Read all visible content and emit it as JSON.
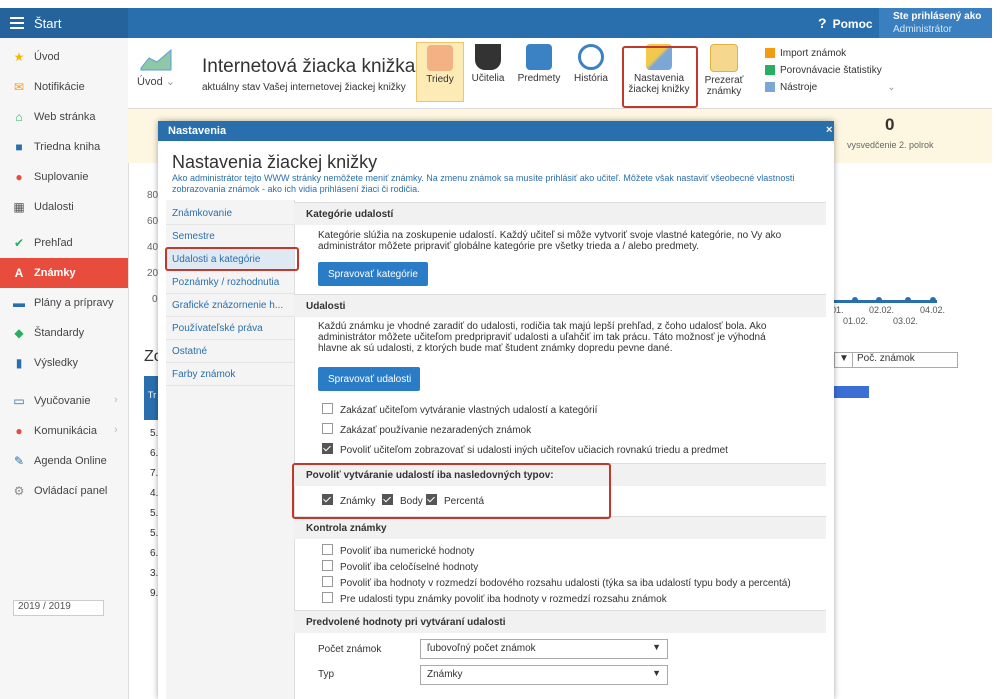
{
  "topbar": {
    "app_label": "Štart",
    "help": "Pomoc",
    "user_line1": "Ste prihlásený ako",
    "user_line2": "Administrátor"
  },
  "sidebar": {
    "items": [
      {
        "label": "Úvod",
        "icon": "star-icon",
        "color": "#f5b800"
      },
      {
        "label": "Notifikácie",
        "icon": "envelope-icon",
        "color": "#f39c12"
      },
      {
        "label": "Web stránka",
        "icon": "home-icon",
        "color": "#27ae60"
      },
      {
        "label": "Triedna kniha",
        "icon": "book-icon",
        "color": "#2a6fad"
      },
      {
        "label": "Suplovanie",
        "icon": "user-icon",
        "color": "#e74c3c"
      },
      {
        "label": "Udalosti",
        "icon": "calendar-icon",
        "color": "#555"
      },
      {
        "label": "Prehľad",
        "icon": "check-circle-icon",
        "color": "#27ae60"
      },
      {
        "label": "Známky",
        "icon": "grade-icon",
        "color": "#fff"
      },
      {
        "label": "Plány a prípravy",
        "icon": "briefcase-icon",
        "color": "#2a6fad"
      },
      {
        "label": "Štandardy",
        "icon": "shield-icon",
        "color": "#27ae60"
      },
      {
        "label": "Výsledky",
        "icon": "bar-chart-icon",
        "color": "#2a6fad"
      },
      {
        "label": "Vyučovanie",
        "icon": "book-open-icon",
        "color": "#2a6fad"
      },
      {
        "label": "Komunikácia",
        "icon": "chat-icon",
        "color": "#e74c3c"
      },
      {
        "label": "Agenda Online",
        "icon": "pencil-icon",
        "color": "#2a6fad"
      },
      {
        "label": "Ovládací panel",
        "icon": "gear-icon",
        "color": "#888"
      }
    ],
    "year": "2019 / 2019"
  },
  "toolbar": {
    "uvod": "Úvod",
    "title": "Internetová žiacka knižka",
    "subtitle": "aktuálny stav Vašej internetovej žiackej knižky",
    "buttons": [
      "Triedy",
      "Učitelia",
      "Predmety",
      "História",
      "Nastavenia žiackej knižky",
      "Prezerať známky"
    ],
    "tools": [
      "Import známok",
      "Porovnávacie štatistiky",
      "Nástroje"
    ]
  },
  "background": {
    "stat_value": "0",
    "stat_label": "vysvedčenie 2. polrok",
    "y_ticks": [
      "80",
      "60",
      "40",
      "20",
      "0"
    ],
    "dates": [
      "01.",
      "02.02.",
      "04.02.",
      "01.02.",
      "03.02."
    ],
    "section_title": "Zo",
    "table_head": "Tr",
    "rows": [
      "5.",
      "6.",
      "7.",
      "4.",
      "5.",
      "5.",
      "6.",
      "3.",
      "9."
    ],
    "select1": "▼",
    "select2": "Poč. známok"
  },
  "modal": {
    "header": "Nastavenia",
    "close": "×",
    "title": "Nastavenia žiackej knižky",
    "desc": "Ako administrátor tejto WWW stránky nemôžete meniť známky. Na zmenu známok sa musíte prihlásiť ako učiteľ. Môžete však nastaviť všeobecné vlastnosti zobrazovania známok - ako ich vidia prihlásení žiaci či rodičia.",
    "nav": [
      "Známkovanie",
      "Semestre",
      "Udalosti a kategórie",
      "Poznámky / rozhodnutia",
      "Grafické znázornenie h...",
      "Používateľské práva",
      "Ostatné",
      "Farby známok"
    ],
    "sections": {
      "kategorie": {
        "head": "Kategórie udalostí",
        "text": "Kategórie slúžia na zoskupenie udalostí. Každý učiteľ si môže vytvoriť svoje vlastné kategórie, no Vy ako administrátor môžete pripraviť globálne kategórie pre všetky trieda a / alebo predmety.",
        "button": "Spravovať kategórie"
      },
      "udalosti": {
        "head": "Udalosti",
        "text": "Každú známku je vhodné zaradiť do udalosti, rodičia tak majú lepší prehľad, z čoho udalosť bola. Ako administrátor môžete učiteľom predpripraviť udalosti a uľahčiť im tak prácu. Táto možnosť je výhodná hlavne ak sú udalosti, z ktorých bude mať študent známky dopredu pevne dané.",
        "button": "Spravovať udalosti",
        "checks": [
          {
            "label": "Zakázať učiteľom vytváranie vlastných udalostí a kategórií",
            "checked": false
          },
          {
            "label": "Zakázať používanie nezaradených známok",
            "checked": false
          },
          {
            "label": "Povoliť učiteľom zobrazovať si udalosti iných učiteľov učiacich rovnakú triedu a predmet",
            "checked": true
          }
        ]
      },
      "typy": {
        "head": "Povoliť vytváranie udalostí iba nasledovných typov:",
        "checks": [
          {
            "label": "Známky",
            "checked": true
          },
          {
            "label": "Body",
            "checked": true
          },
          {
            "label": "Percentá",
            "checked": true
          }
        ]
      },
      "kontrola": {
        "head": "Kontrola známky",
        "checks": [
          {
            "label": "Povoliť iba numerické hodnoty",
            "checked": false
          },
          {
            "label": "Povoliť iba celočíselné hodnoty",
            "checked": false
          },
          {
            "label": "Povoliť iba hodnoty v rozmedzí bodového rozsahu udalosti (týka sa iba udalostí typu body a percentá)",
            "checked": false
          },
          {
            "label": "Pre udalosti typu známky povoliť iba hodnoty v rozmedzí rozsahu známok",
            "checked": false
          }
        ]
      },
      "predvolene": {
        "head": "Predvolené hodnoty pri vytváraní udalosti",
        "fields": [
          {
            "label": "Počet známok",
            "value": "ľubovoľný počet známok"
          },
          {
            "label": "Typ",
            "value": "Známky"
          }
        ]
      }
    }
  }
}
